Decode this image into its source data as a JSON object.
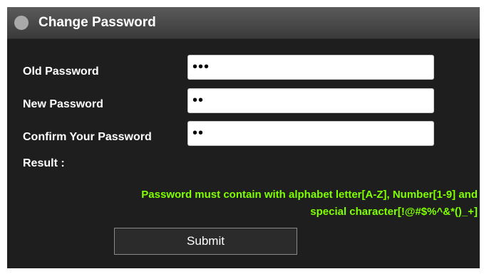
{
  "window": {
    "title": "Change Password"
  },
  "form": {
    "old_password": {
      "label": "Old Password",
      "value": "•••"
    },
    "new_password": {
      "label": "New Password",
      "value": "••"
    },
    "confirm_password": {
      "label": "Confirm Your Password",
      "value": "••"
    },
    "result_label": "Result :"
  },
  "message": {
    "line1": "Password must contain with alphabet letter[A-Z], Number[1-9] and",
    "line2": "special character[!@#$%^&*()_+]",
    "color": "#7fff00"
  },
  "actions": {
    "submit_label": "Submit"
  }
}
